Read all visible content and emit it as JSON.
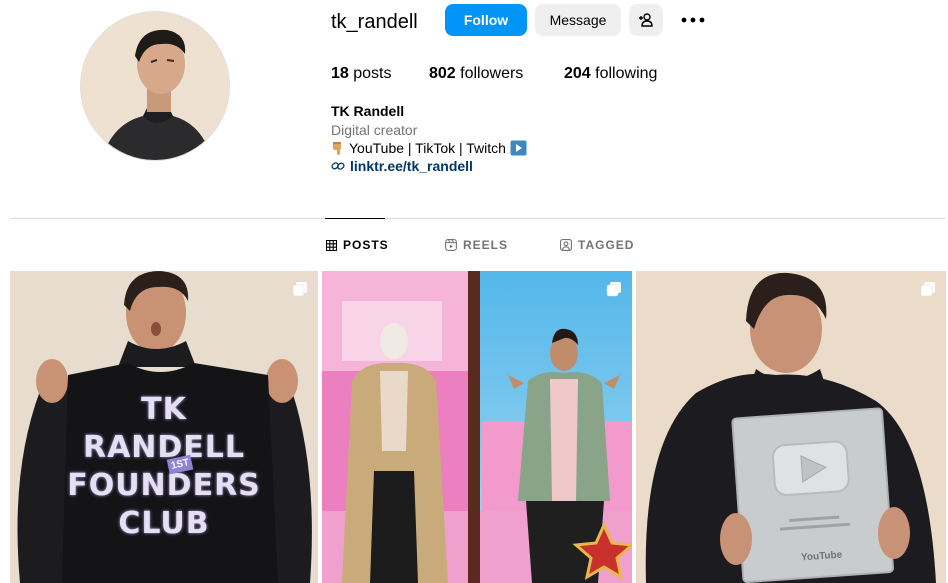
{
  "profile": {
    "username": "tk_randell",
    "follow_label": "Follow",
    "message_label": "Message",
    "add_icon": "person-add-icon",
    "more_icon": "more-options-icon",
    "stats": {
      "posts_count": "18",
      "posts_label": "posts",
      "followers_count": "802",
      "followers_label": "followers",
      "following_count": "204",
      "following_label": "following"
    },
    "full_name": "TK Randell",
    "category": "Digital creator",
    "bio_line": "YouTube | TikTok | Twitch",
    "link": "linktr.ee/tk_randell"
  },
  "tabs": [
    {
      "label": "POSTS",
      "icon": "grid-icon",
      "active": true
    },
    {
      "label": "REELS",
      "icon": "reels-icon",
      "active": false
    },
    {
      "label": "TAGGED",
      "icon": "tagged-icon",
      "active": false
    }
  ],
  "posts": [
    {
      "shirt_text": [
        "TK",
        "RANDELL",
        "FOUNDERS",
        "CLUB"
      ],
      "badge": "1ST",
      "multi": true
    },
    {
      "multi": true
    },
    {
      "plaque_brand": "YouTube",
      "multi": true
    }
  ],
  "colors": {
    "accent": "#0095f6",
    "link": "#00376b",
    "secondary_text": "#737373",
    "divider": "#dbdbdb"
  }
}
